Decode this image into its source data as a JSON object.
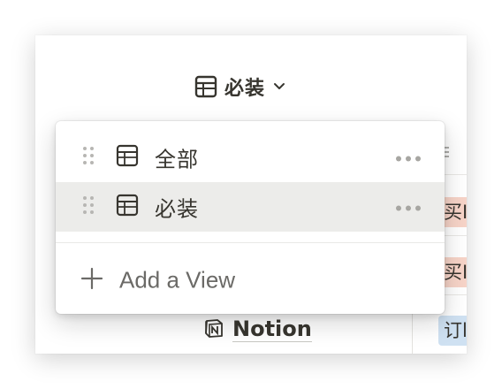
{
  "header": {
    "current_view": "必装"
  },
  "table": {
    "property_header_fragment": "⁝",
    "tags": [
      {
        "text": "买I",
        "color": "#f7d4c8"
      },
      {
        "text": "买I",
        "color": "#f7d4c8"
      },
      {
        "text": "订l",
        "color": "#cfe1f2"
      }
    ],
    "notion_link": "Notion"
  },
  "menu": {
    "views": [
      {
        "name": "全部",
        "selected": false
      },
      {
        "name": "必装",
        "selected": true
      }
    ],
    "add_view_label": "Add a View"
  },
  "icons": {
    "view_type": "table-icon",
    "drag": "drag-handle-icon",
    "more": "more-horizontal-icon",
    "add": "plus-icon",
    "chevron": "chevron-down-icon",
    "notion": "notion-logo-icon"
  },
  "colors": {
    "text_primary": "#37352f",
    "text_secondary": "#9b9a97",
    "selected_bg": "#ececea",
    "tag_pink": "#f7d4c8",
    "tag_blue": "#cfe1f2"
  }
}
